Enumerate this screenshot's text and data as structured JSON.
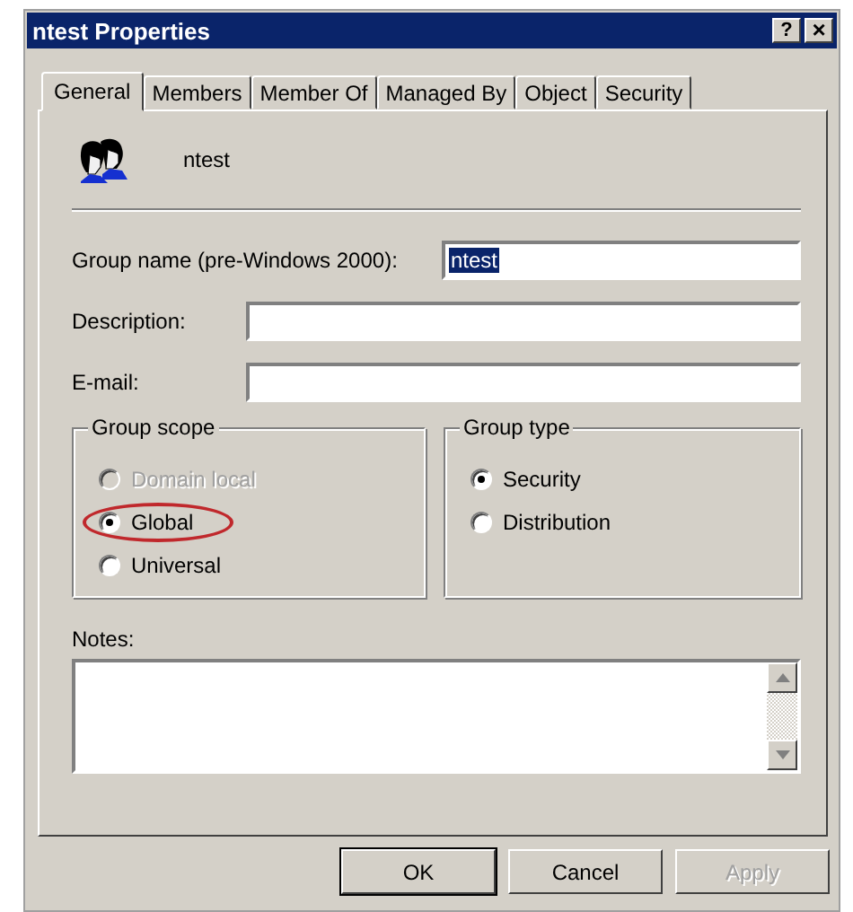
{
  "window": {
    "title": "ntest Properties",
    "title_buttons": [
      {
        "kind": "help",
        "label": "?"
      },
      {
        "kind": "close",
        "label": "×"
      }
    ]
  },
  "tabs": [
    {
      "label": "General",
      "selected": true
    },
    {
      "label": "Members",
      "selected": false
    },
    {
      "label": "Member Of",
      "selected": false
    },
    {
      "label": "Managed By",
      "selected": false
    },
    {
      "label": "Object",
      "selected": false
    },
    {
      "label": "Security",
      "selected": false
    }
  ],
  "header": {
    "name": "ntest"
  },
  "fields": [
    {
      "label": "Group name (pre-Windows 2000):",
      "value": "ntest",
      "text_selected": true
    },
    {
      "label": "Description:"
    },
    {
      "label": "E-mail:"
    }
  ],
  "groups": [
    {
      "title": "Group scope",
      "options": [
        {
          "label": "Domain local",
          "selected": false,
          "disabled": true,
          "highlighted": false
        },
        {
          "label": "Global",
          "selected": true,
          "disabled": false,
          "highlighted": true
        },
        {
          "label": "Universal",
          "selected": false,
          "disabled": false,
          "highlighted": false
        }
      ]
    },
    {
      "title": "Group type",
      "options": [
        {
          "label": "Security",
          "selected": true,
          "disabled": false,
          "highlighted": false
        },
        {
          "label": "Distribution",
          "selected": false,
          "disabled": false,
          "highlighted": false
        }
      ]
    }
  ],
  "notes": {
    "label": "Notes:"
  },
  "buttons": [
    {
      "label": "OK",
      "disabled": false,
      "default": true
    },
    {
      "label": "Cancel",
      "disabled": false,
      "default": false
    },
    {
      "label": "Apply",
      "disabled": true,
      "default": false
    }
  ]
}
